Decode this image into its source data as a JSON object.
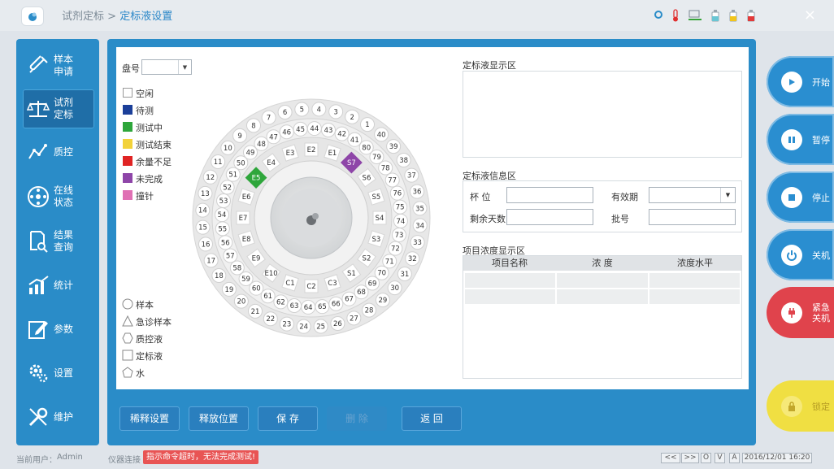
{
  "breadcrumb": {
    "parent": "试剂定标",
    "sep": ">",
    "current": "定标液设置"
  },
  "close": "×",
  "nav": [
    {
      "label": "样本\n申请",
      "icon": "test-tube-icon"
    },
    {
      "label": "试剂\n定标",
      "icon": "balance-scale-icon"
    },
    {
      "label": "质控",
      "icon": "qc-chart-icon"
    },
    {
      "label": "在线\n状态",
      "icon": "status-wheel-icon"
    },
    {
      "label": "结果\n查询",
      "icon": "result-search-icon"
    },
    {
      "label": "统计",
      "icon": "bar-chart-icon"
    },
    {
      "label": "参数",
      "icon": "edit-icon"
    },
    {
      "label": "设置",
      "icon": "gear-icon"
    },
    {
      "label": "维护",
      "icon": "tools-icon"
    }
  ],
  "plate": {
    "label": "盘号",
    "value": ""
  },
  "legend": [
    {
      "label": "空闲",
      "color": "#ffffff"
    },
    {
      "label": "待测",
      "color": "#1b3f99"
    },
    {
      "label": "测试中",
      "color": "#2ea63b"
    },
    {
      "label": "测试结束",
      "color": "#f2d23a"
    },
    {
      "label": "余量不足",
      "color": "#e02424"
    },
    {
      "label": "未完成",
      "color": "#8e45a8"
    },
    {
      "label": "撞针",
      "color": "#e070b4"
    }
  ],
  "shapes": [
    {
      "label": "样本",
      "shape": "circle"
    },
    {
      "label": "急诊样本",
      "shape": "triangle"
    },
    {
      "label": "质控液",
      "shape": "hexagon"
    },
    {
      "label": "定标液",
      "shape": "square"
    },
    {
      "label": "水",
      "shape": "pentagon"
    }
  ],
  "display_area": {
    "title": "定标液显示区"
  },
  "info_area": {
    "title": "定标液信息区",
    "cup_label": "杯    位",
    "cup_value": "",
    "expiry_label": "有效期",
    "expiry_value": "",
    "days_label": "剩余天数",
    "days_value": "",
    "batch_label": "批号",
    "batch_value": ""
  },
  "conc_area": {
    "title": "项目浓度显示区",
    "columns": [
      "项目名称",
      "浓    度",
      "浓度水平"
    ],
    "rows": [
      [
        "",
        "",
        ""
      ],
      [
        "",
        "",
        ""
      ]
    ]
  },
  "buttons": {
    "dilute": "稀释设置",
    "release": "释放位置",
    "save": "保   存",
    "delete": "删   除",
    "back": "返   回"
  },
  "right": {
    "start": "开始",
    "pause": "暂停",
    "stop": "停止",
    "shutdown": "关机",
    "emergency": "紧急\n关机",
    "lock": "锁定"
  },
  "status": {
    "user_label": "当前用户：",
    "user": "Admin",
    "conn_label": "仪器连接",
    "warning": "指示命令超时，无法完成测试!",
    "datetime": "2016/12/01 16:20",
    "b_prev": "<<",
    "b_next": ">>",
    "b_o": "O",
    "b_v": "V",
    "b_a": "A"
  },
  "wheel": {
    "outer": [
      "1",
      "2",
      "3",
      "4",
      "5",
      "6",
      "7",
      "8",
      "9",
      "10",
      "11",
      "12",
      "13",
      "14",
      "15",
      "16",
      "17",
      "18",
      "19",
      "20",
      "21",
      "22",
      "23",
      "24",
      "25",
      "26",
      "27",
      "28",
      "29",
      "30",
      "31",
      "32",
      "33",
      "34",
      "35",
      "36",
      "37",
      "38",
      "39",
      "40"
    ],
    "middle": [
      "41",
      "42",
      "43",
      "44",
      "45",
      "46",
      "47",
      "48",
      "49",
      "50",
      "51",
      "52",
      "53",
      "54",
      "55",
      "56",
      "57",
      "58",
      "59",
      "60",
      "61",
      "62",
      "63",
      "64",
      "65",
      "66",
      "67",
      "68",
      "69",
      "70",
      "71",
      "72",
      "73",
      "74",
      "75",
      "76",
      "77",
      "78",
      "79",
      "80"
    ],
    "inner": [
      {
        "label": "E1",
        "color": "#ffffff",
        "text": "#333"
      },
      {
        "label": "E2",
        "color": "#ffffff",
        "text": "#333"
      },
      {
        "label": "E3",
        "color": "#ffffff",
        "text": "#333"
      },
      {
        "label": "E4",
        "color": "#ffffff",
        "text": "#333"
      },
      {
        "label": "E5",
        "color": "#2ea63b",
        "text": "#ffffff"
      },
      {
        "label": "E6",
        "color": "#ffffff",
        "text": "#333"
      },
      {
        "label": "E7",
        "color": "#ffffff",
        "text": "#333"
      },
      {
        "label": "E8",
        "color": "#ffffff",
        "text": "#333"
      },
      {
        "label": "E9",
        "color": "#ffffff",
        "text": "#333"
      },
      {
        "label": "E10",
        "color": "#ffffff",
        "text": "#333"
      },
      {
        "label": "C1",
        "color": "#ffffff",
        "text": "#333"
      },
      {
        "label": "C2",
        "color": "#ffffff",
        "text": "#333"
      },
      {
        "label": "C3",
        "color": "#ffffff",
        "text": "#333"
      },
      {
        "label": "S1",
        "color": "#ffffff",
        "text": "#333"
      },
      {
        "label": "S2",
        "color": "#ffffff",
        "text": "#333"
      },
      {
        "label": "S3",
        "color": "#ffffff",
        "text": "#333"
      },
      {
        "label": "S4",
        "color": "#ffffff",
        "text": "#333"
      },
      {
        "label": "S5",
        "color": "#ffffff",
        "text": "#333"
      },
      {
        "label": "S6",
        "color": "#ffffff",
        "text": "#333"
      },
      {
        "label": "S7",
        "color": "#8e45a8",
        "text": "#ffffff"
      }
    ]
  }
}
